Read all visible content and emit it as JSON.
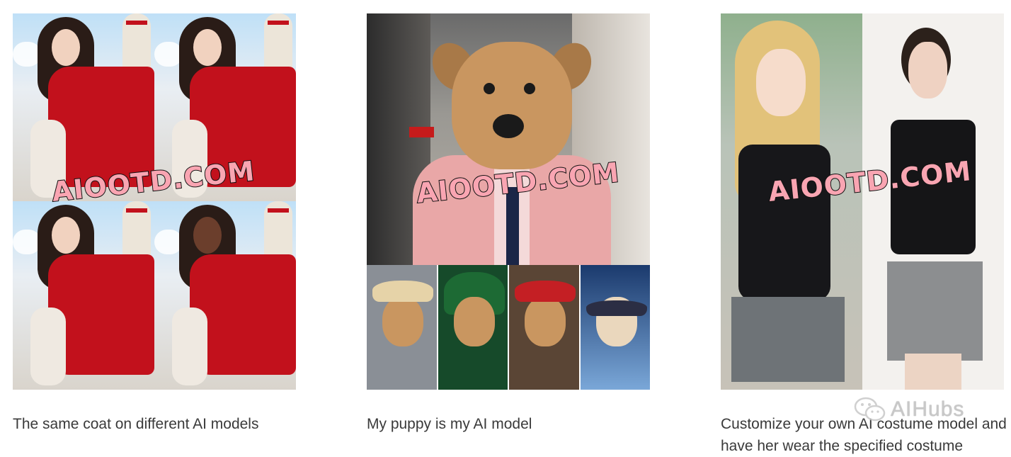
{
  "cards": [
    {
      "watermark": "AIOOTD.COM",
      "caption": "The same coat on different AI models"
    },
    {
      "watermark": "AIOOTD.COM",
      "caption": "My puppy is my AI model"
    },
    {
      "watermark": "AIOOTD.COM",
      "caption": "Customize your own AI costume model and have her wear the specified costume"
    }
  ],
  "brand": {
    "label": "AIHubs",
    "icon": "wechat-icon"
  },
  "colors": {
    "watermark_fill": "#f9a5b2",
    "jacket_red": "#c2111c",
    "caption_text": "#3a3a3a"
  }
}
